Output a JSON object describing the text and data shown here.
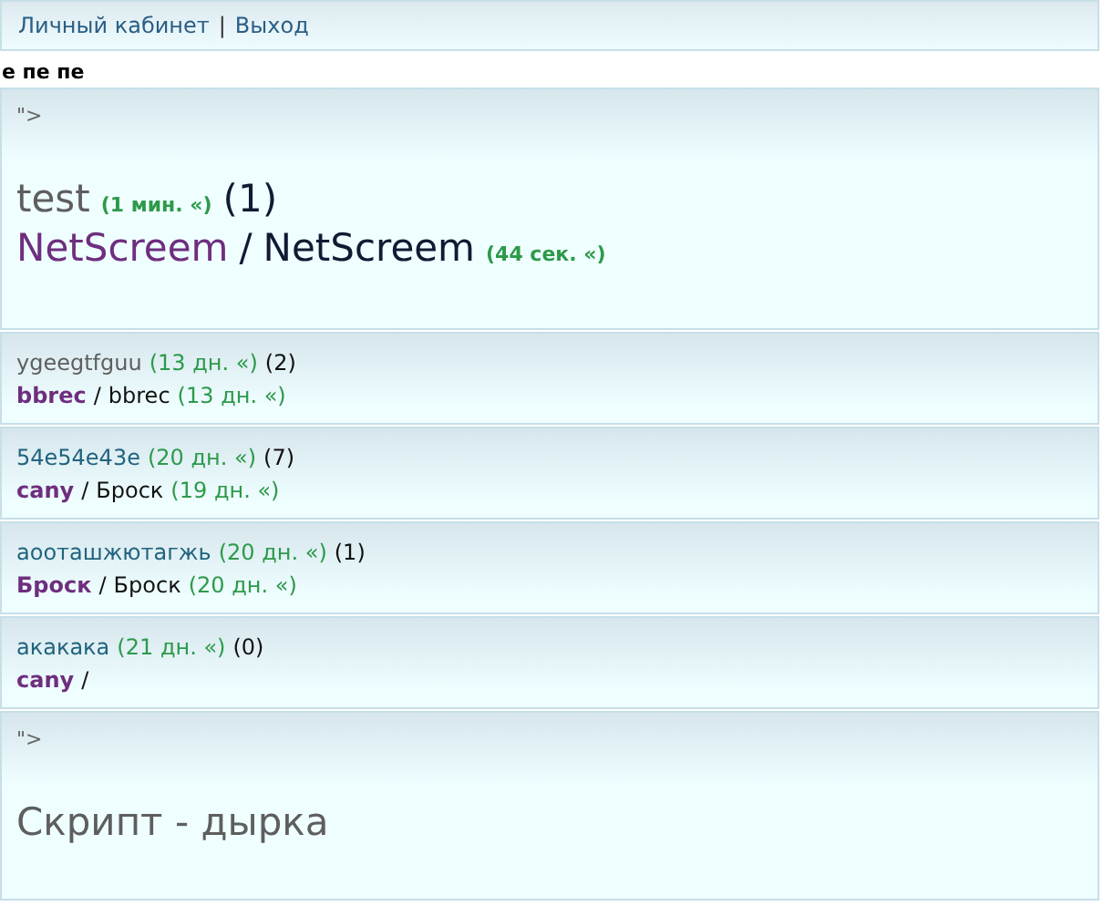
{
  "top_links": [
    "Личный кабинет",
    "Выход"
  ],
  "separator": "|",
  "heading": "е пе пе",
  "topics": [
    {
      "kind": "large",
      "prefix": "\">",
      "title": "test",
      "visited": true,
      "time": "(1 мин. «)",
      "count": "(1)",
      "last_author": "NetScreem",
      "slash": "/",
      "author": "NetScreem",
      "last_time": "(44 сек. «)"
    },
    {
      "kind": "small",
      "title": "ygeegtfguu",
      "visited": true,
      "time": "(13 дн. «)",
      "count": "(2)",
      "last_author": "bbrec",
      "slash": "/",
      "author": "bbrec",
      "last_time": "(13 дн. «)"
    },
    {
      "kind": "small",
      "title": "54e54e43e",
      "visited": false,
      "time": "(20 дн. «)",
      "count": "(7)",
      "last_author": "cany",
      "slash": "/",
      "author": "Броск",
      "last_time": "(19 дн. «)"
    },
    {
      "kind": "small",
      "title": "аооташжютагжь",
      "visited": false,
      "time": "(20 дн. «)",
      "count": "(1)",
      "last_author": "Броск",
      "slash": "/",
      "author": "Броск",
      "last_time": "(20 дн. «)"
    },
    {
      "kind": "small",
      "title": "акакака",
      "visited": false,
      "time": "(21 дн. «)",
      "count": "(0)",
      "last_author": "cany",
      "slash": "/"
    },
    {
      "kind": "large",
      "prefix": "\">",
      "title": "Скрипт - дырка",
      "visited": true
    }
  ]
}
